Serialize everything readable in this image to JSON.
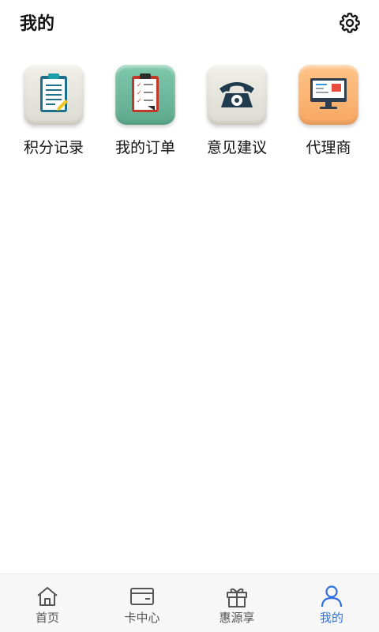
{
  "header": {
    "title": "我的",
    "settings_icon": "gear-icon"
  },
  "menu": [
    {
      "label": "积分记录",
      "icon": "clipboard-icon",
      "tile_color": "#e4e3da"
    },
    {
      "label": "我的订单",
      "icon": "order-list-icon",
      "tile_color": "#6db69b"
    },
    {
      "label": "意见建议",
      "icon": "telephone-icon",
      "tile_color": "#e4e3da"
    },
    {
      "label": "代理商",
      "icon": "monitor-icon",
      "tile_color": "#fbb36f"
    }
  ],
  "tabbar": {
    "active_color": "#2f6fe0",
    "inactive_color": "#555555",
    "tabs": [
      {
        "label": "首页",
        "icon": "home-icon",
        "active": false
      },
      {
        "label": "卡中心",
        "icon": "card-icon",
        "active": false
      },
      {
        "label": "惠源享",
        "icon": "gift-icon",
        "active": false
      },
      {
        "label": "我的",
        "icon": "user-icon",
        "active": true
      }
    ]
  }
}
